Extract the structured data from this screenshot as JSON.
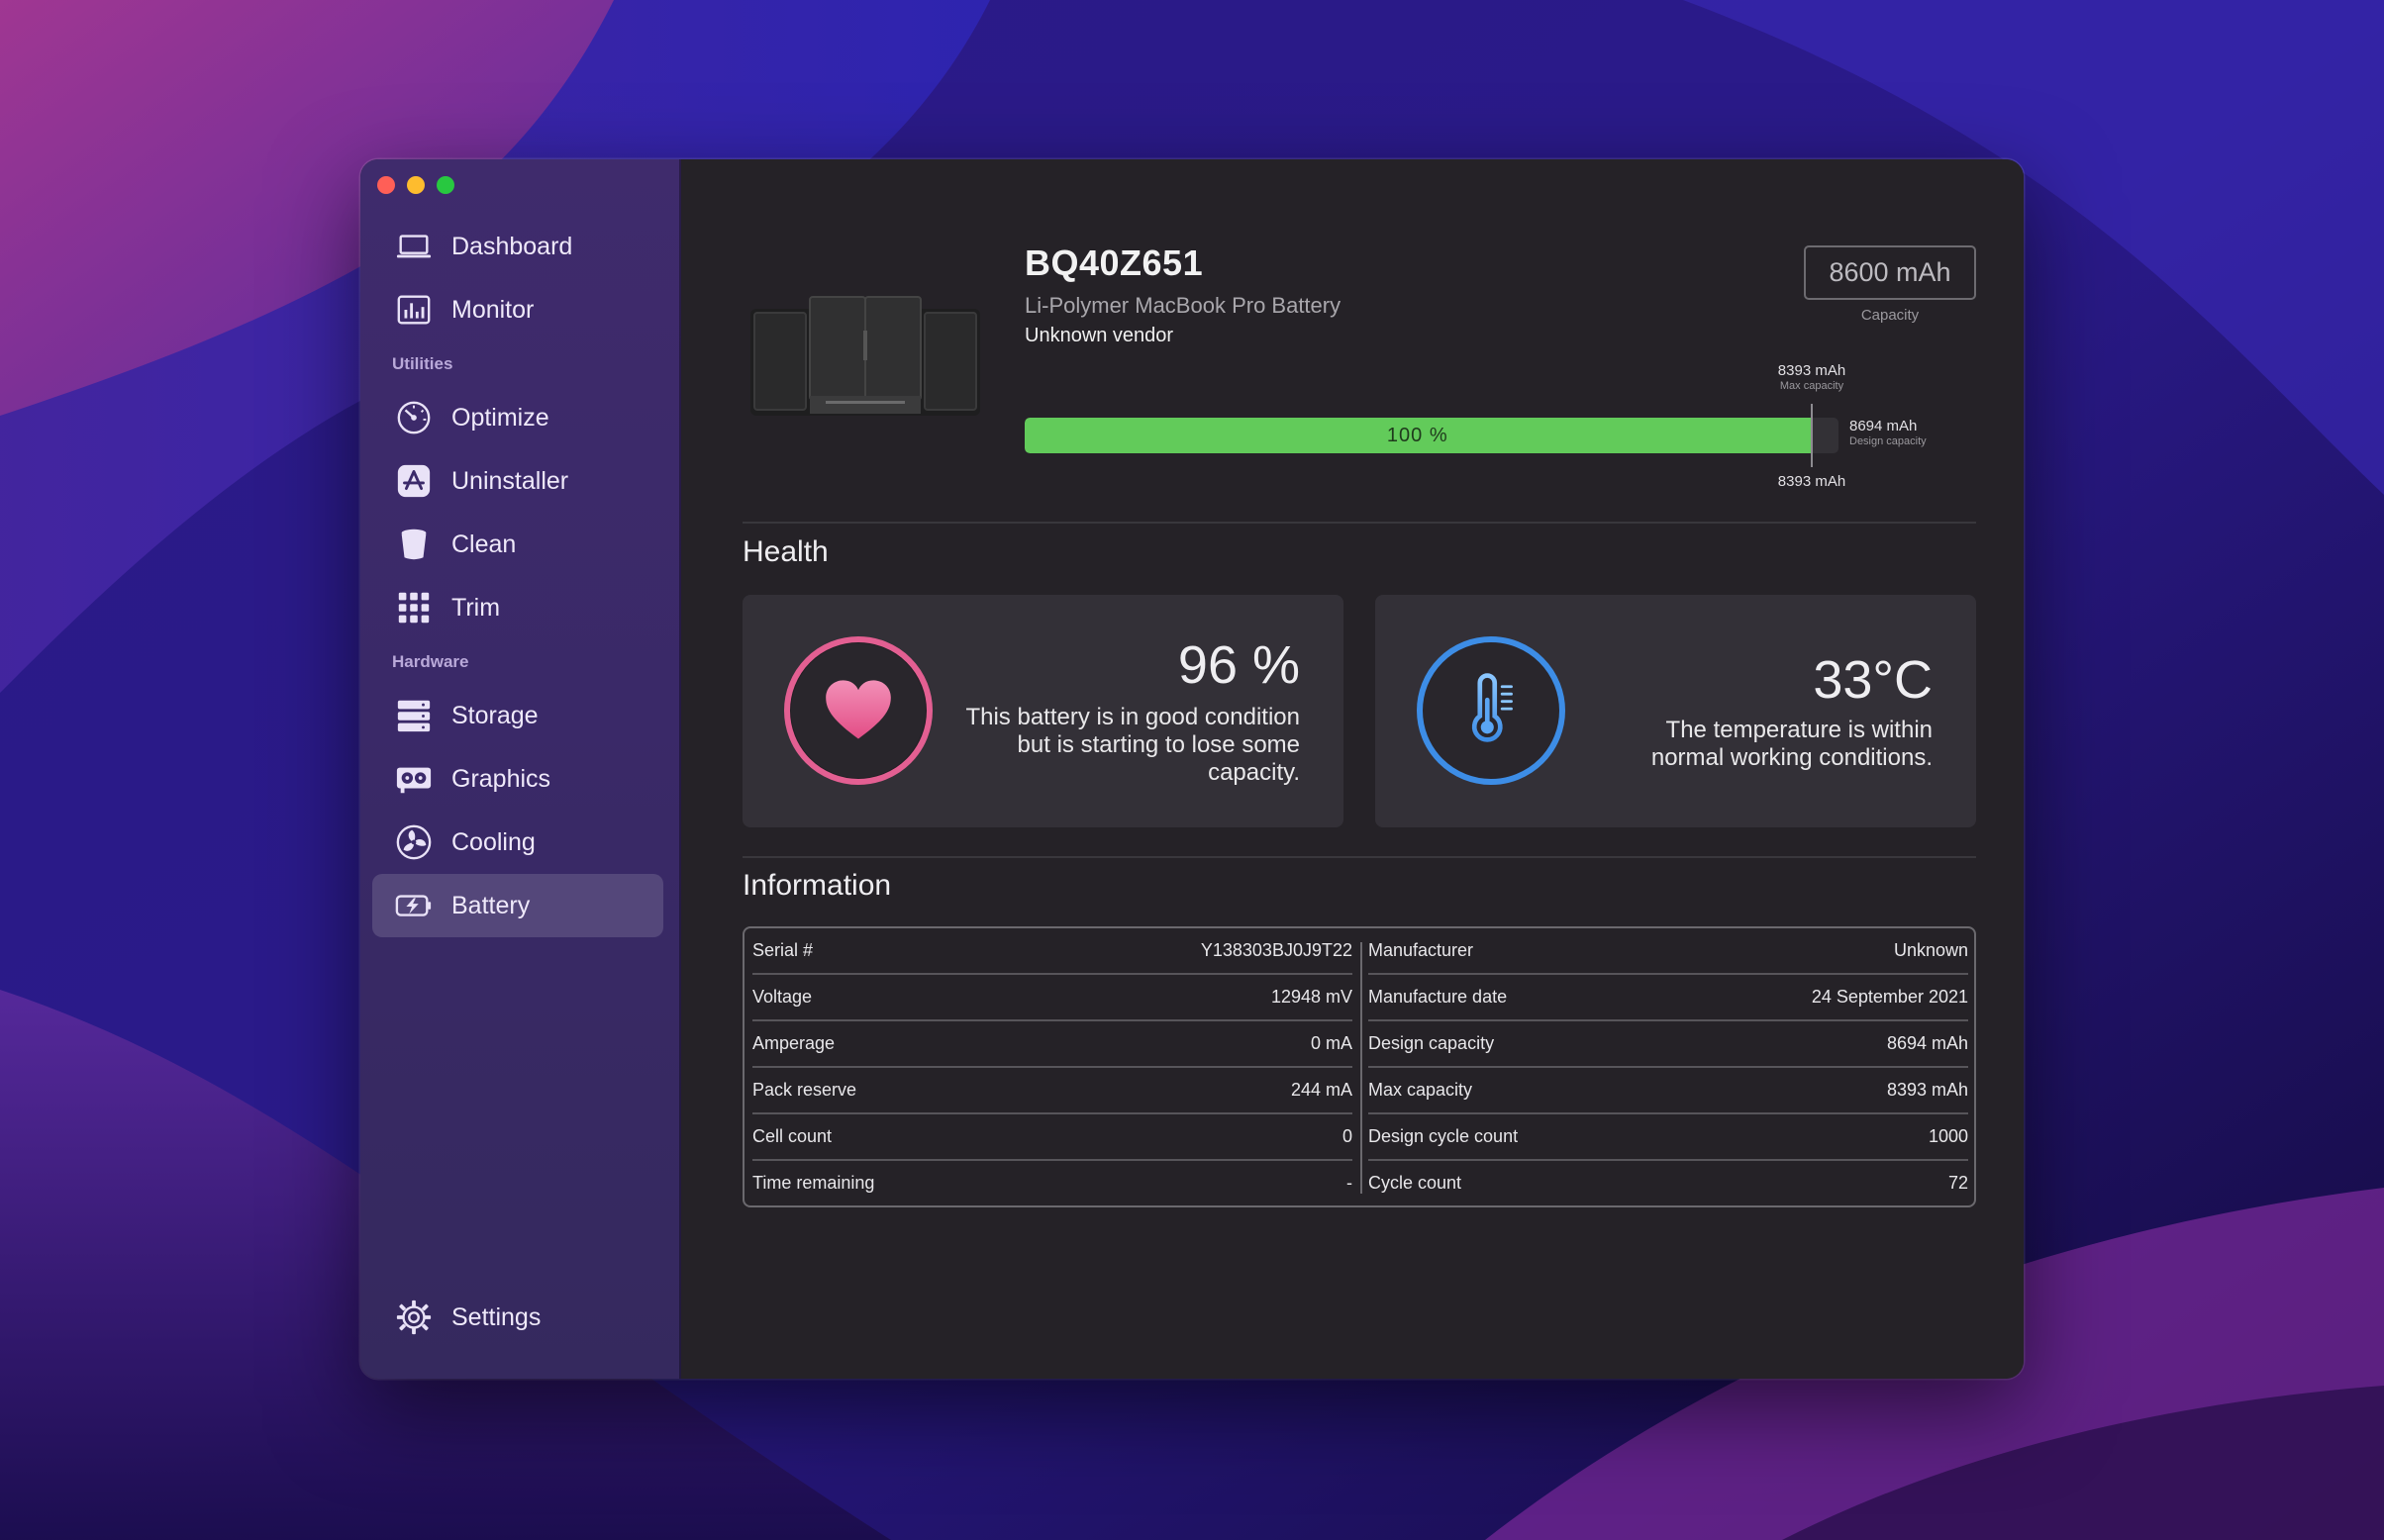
{
  "colors": {
    "accent_green": "#62cb5a",
    "heart_ring": "#e35f92",
    "temp_ring": "#3d8de6",
    "sidebar_bg": "#3a2968",
    "main_bg": "#252227"
  },
  "sidebar": {
    "top_items": [
      {
        "label": "Dashboard",
        "icon": "laptop-icon"
      },
      {
        "label": "Monitor",
        "icon": "bar-chart-icon"
      }
    ],
    "utilities_header": "Utilities",
    "utilities_items": [
      {
        "label": "Optimize",
        "icon": "gauge-icon"
      },
      {
        "label": "Uninstaller",
        "icon": "app-store-icon"
      },
      {
        "label": "Clean",
        "icon": "trash-bin-icon"
      },
      {
        "label": "Trim",
        "icon": "grid-icon"
      }
    ],
    "hardware_header": "Hardware",
    "hardware_items": [
      {
        "label": "Storage",
        "icon": "storage-icon"
      },
      {
        "label": "Graphics",
        "icon": "graphics-card-icon"
      },
      {
        "label": "Cooling",
        "icon": "fan-icon"
      },
      {
        "label": "Battery",
        "icon": "battery-charging-icon",
        "active": true
      }
    ],
    "settings": {
      "label": "Settings",
      "icon": "gear-icon"
    }
  },
  "battery": {
    "model": "BQ40Z651",
    "type": "Li-Polymer MacBook Pro Battery",
    "vendor": "Unknown vendor",
    "capacity_value": "8600 mAh",
    "capacity_label": "Capacity",
    "charge_percent_label": "100 %",
    "charge_fraction": 1.0,
    "max_capacity_fraction": 0.9654,
    "marker_top_value": "8393 mAh",
    "marker_top_label": "Max capacity",
    "marker_right_value": "8694 mAh",
    "marker_right_label": "Design capacity",
    "marker_bottom_value": "8393 mAh"
  },
  "health": {
    "title": "Health",
    "battery_health": {
      "value": "96 %",
      "description": "This battery is in good condition but is starting to lose some capacity.",
      "icon": "heart-icon"
    },
    "temperature": {
      "value": "33°C",
      "description": "The temperature is within normal working conditions.",
      "icon": "thermometer-icon"
    }
  },
  "information": {
    "title": "Information",
    "left": [
      {
        "label": "Serial #",
        "value": "Y138303BJ0J9T22"
      },
      {
        "label": "Voltage",
        "value": "12948 mV"
      },
      {
        "label": "Amperage",
        "value": "0 mA"
      },
      {
        "label": "Pack reserve",
        "value": "244 mA"
      },
      {
        "label": "Cell count",
        "value": "0"
      },
      {
        "label": "Time remaining",
        "value": "-"
      }
    ],
    "right": [
      {
        "label": "Manufacturer",
        "value": "Unknown"
      },
      {
        "label": "Manufacture date",
        "value": "24 September 2021"
      },
      {
        "label": "Design capacity",
        "value": "8694 mAh"
      },
      {
        "label": "Max capacity",
        "value": "8393 mAh"
      },
      {
        "label": "Design cycle count",
        "value": "1000"
      },
      {
        "label": "Cycle count",
        "value": "72"
      }
    ]
  }
}
